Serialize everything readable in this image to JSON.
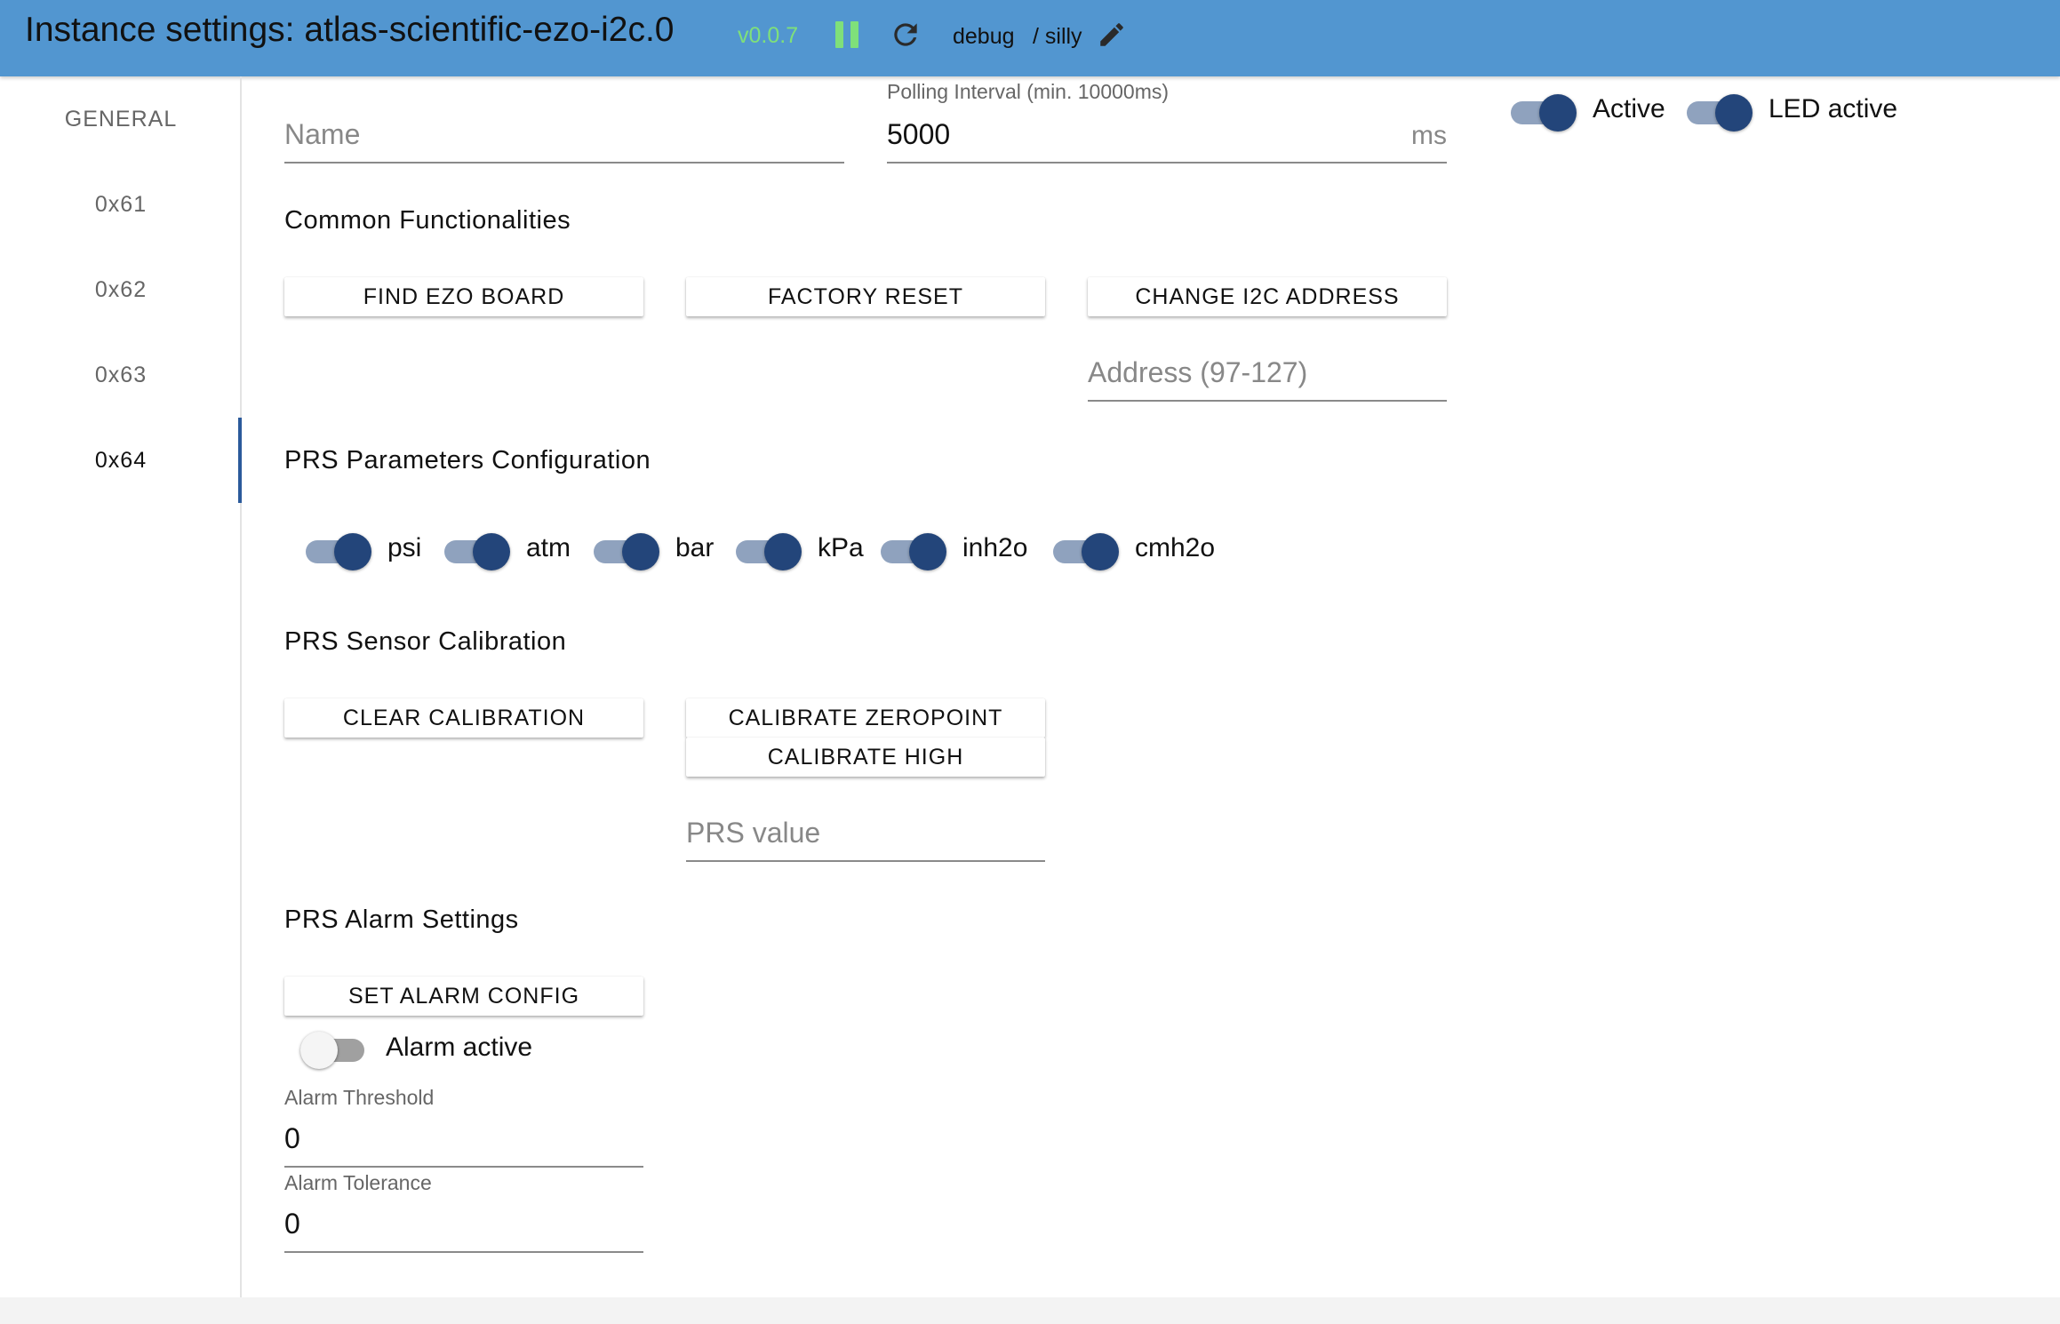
{
  "header": {
    "title": "Instance settings: atlas-scientific-ezo-i2c.0",
    "version": "v0.0.7",
    "log_level": "debug",
    "log_level_alt": "/ silly",
    "icons": [
      "pause-icon",
      "refresh-icon",
      "pencil-icon"
    ],
    "bg_color": "#5296d0",
    "accent_color": "#7fe07a"
  },
  "sidebar": {
    "tabs": [
      {
        "label": "GENERAL"
      },
      {
        "label": "0x61"
      },
      {
        "label": "0x62"
      },
      {
        "label": "0x63"
      },
      {
        "label": "0x64"
      }
    ],
    "selected": "0x64"
  },
  "general": {
    "name_placeholder": "Name",
    "polling_label": "Polling Interval (min. 10000ms)",
    "polling_value": "5000",
    "polling_unit": "ms",
    "active_label": "Active",
    "active_on": true,
    "led_label": "LED active",
    "led_on": true
  },
  "common": {
    "title": "Common Functionalities",
    "find_button": "FIND EZO BOARD",
    "reset_button": "FACTORY RESET",
    "change_address_button": "CHANGE I2C ADDRESS",
    "address_placeholder": "Address (97-127)"
  },
  "prs_params": {
    "title": "PRS Parameters Configuration",
    "units": [
      {
        "label": "psi",
        "on": true
      },
      {
        "label": "atm",
        "on": true
      },
      {
        "label": "bar",
        "on": true
      },
      {
        "label": "kPa",
        "on": true
      },
      {
        "label": "inh2o",
        "on": true
      },
      {
        "label": "cmh2o",
        "on": true
      }
    ]
  },
  "prs_calibration": {
    "title": "PRS Sensor Calibration",
    "clear_button": "CLEAR CALIBRATION",
    "zeropoint_button": "CALIBRATE ZEROPOINT",
    "high_button": "CALIBRATE HIGH",
    "value_placeholder": "PRS value"
  },
  "prs_alarm": {
    "title": "PRS Alarm Settings",
    "set_button": "SET ALARM CONFIG",
    "alarm_active_label": "Alarm active",
    "alarm_active_on": false,
    "threshold_label": "Alarm Threshold",
    "threshold_value": "0",
    "tolerance_label": "Alarm Tolerance",
    "tolerance_value": "0"
  },
  "toggle_colors": {
    "thumb": "#23457a",
    "track": "#8fa2be"
  }
}
